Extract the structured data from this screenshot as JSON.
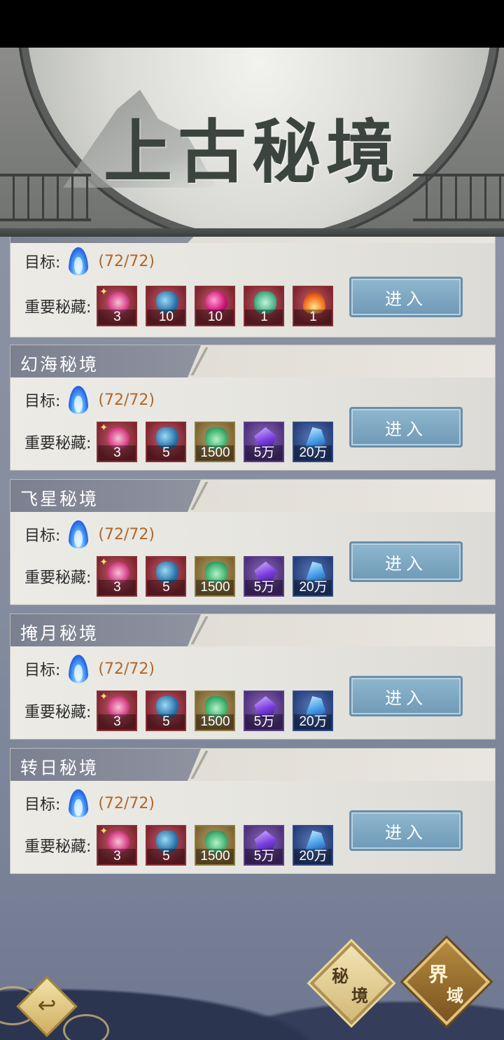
{
  "header": {
    "title": "上古秘境"
  },
  "labels": {
    "goal": "目标:",
    "loot": "重要秘藏:",
    "enter": "进入"
  },
  "cards": [
    {
      "name": "",
      "progress": "(72/72)",
      "items": [
        {
          "icon": "pink-gem-icon",
          "count": "3",
          "rarity": "red",
          "star": true
        },
        {
          "icon": "blue-bottle-icon",
          "count": "10",
          "rarity": "red"
        },
        {
          "icon": "magenta-orb-icon",
          "count": "10",
          "rarity": "red"
        },
        {
          "icon": "jade-flower-icon",
          "count": "1",
          "rarity": "red"
        },
        {
          "icon": "fire-icon",
          "count": "1",
          "rarity": "red"
        }
      ]
    },
    {
      "name": "幻海秘境",
      "progress": "(72/72)",
      "items": [
        {
          "icon": "pink-gem-icon",
          "count": "3",
          "rarity": "red",
          "star": true
        },
        {
          "icon": "blue-bottle-icon",
          "count": "5",
          "rarity": "red"
        },
        {
          "icon": "jade-vase-icon",
          "count": "1500",
          "rarity": "green"
        },
        {
          "icon": "amethyst-icon",
          "count": "5万",
          "rarity": "purple"
        },
        {
          "icon": "blue-crystal-icon",
          "count": "20万",
          "rarity": "blue"
        }
      ]
    },
    {
      "name": "飞星秘境",
      "progress": "(72/72)",
      "items": [
        {
          "icon": "pink-gem-icon",
          "count": "3",
          "rarity": "red",
          "star": true
        },
        {
          "icon": "blue-bottle-icon",
          "count": "5",
          "rarity": "red"
        },
        {
          "icon": "jade-vase-icon",
          "count": "1500",
          "rarity": "green"
        },
        {
          "icon": "amethyst-icon",
          "count": "5万",
          "rarity": "purple"
        },
        {
          "icon": "blue-crystal-icon",
          "count": "20万",
          "rarity": "blue"
        }
      ]
    },
    {
      "name": "掩月秘境",
      "progress": "(72/72)",
      "items": [
        {
          "icon": "pink-gem-icon",
          "count": "3",
          "rarity": "red",
          "star": true
        },
        {
          "icon": "blue-bottle-icon",
          "count": "5",
          "rarity": "red"
        },
        {
          "icon": "jade-vase-icon",
          "count": "1500",
          "rarity": "green"
        },
        {
          "icon": "amethyst-icon",
          "count": "5万",
          "rarity": "purple"
        },
        {
          "icon": "blue-crystal-icon",
          "count": "20万",
          "rarity": "blue"
        }
      ]
    },
    {
      "name": "转日秘境",
      "progress": "(72/72)",
      "items": [
        {
          "icon": "pink-gem-icon",
          "count": "3",
          "rarity": "red",
          "star": true
        },
        {
          "icon": "blue-bottle-icon",
          "count": "5",
          "rarity": "red"
        },
        {
          "icon": "jade-vase-icon",
          "count": "1500",
          "rarity": "green"
        },
        {
          "icon": "amethyst-icon",
          "count": "5万",
          "rarity": "purple"
        },
        {
          "icon": "blue-crystal-icon",
          "count": "20万",
          "rarity": "blue"
        }
      ]
    }
  ],
  "nav": {
    "secret_realm": [
      "秘",
      "境"
    ],
    "realm_domain": [
      "界",
      "域"
    ]
  },
  "colors": {
    "progress": "#b0672a",
    "enter_button": "#7fa8c2",
    "tab": "#858a98"
  }
}
